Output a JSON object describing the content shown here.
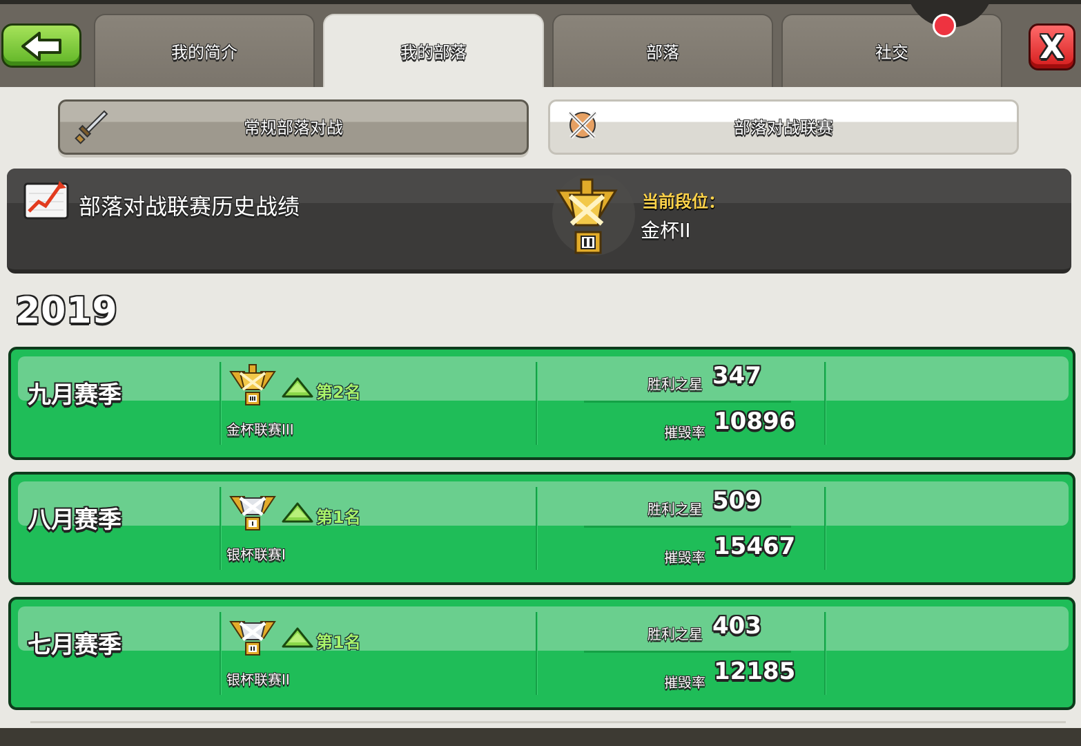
{
  "tabs": [
    {
      "label": "我的简介"
    },
    {
      "label": "我的部落"
    },
    {
      "label": "部落"
    },
    {
      "label": "社交"
    }
  ],
  "close_label": "X",
  "subtabs": {
    "regular": "常规部落对战",
    "league": "部落对战联赛"
  },
  "history": {
    "title": "部落对战联赛历史战绩",
    "current_label": "当前段位：",
    "current_value": "金杯II"
  },
  "year": "2019",
  "seasons": [
    {
      "name": "九月赛季",
      "rank": "第2名",
      "league": "金杯联赛III",
      "stars_label": "胜利之星",
      "stars": "347",
      "destruction_label": "摧毁率",
      "destruction": "10896",
      "trophy": "gold"
    },
    {
      "name": "八月赛季",
      "rank": "第1名",
      "league": "银杯联赛I",
      "stars_label": "胜利之星",
      "stars": "509",
      "destruction_label": "摧毁率",
      "destruction": "15467",
      "trophy": "silver"
    },
    {
      "name": "七月赛季",
      "rank": "第1名",
      "league": "银杯联赛II",
      "stars_label": "胜利之星",
      "stars": "403",
      "destruction_label": "摧毁率",
      "destruction": "12185",
      "trophy": "silver"
    }
  ],
  "colors": {
    "season_green": "#1fbd58",
    "rank_green": "#a9f36a",
    "gold_label": "#ffd44a",
    "close_red": "#d41c1c",
    "back_green": "#5fb426"
  },
  "icons": {
    "back": "back-arrow-icon",
    "close": "close-icon",
    "sword": "sword-icon",
    "league_war": "crossed-swords-shield-icon",
    "chart": "chart-icon",
    "trophy": "trophy-icon",
    "promotion": "promotion-arrow-icon"
  }
}
